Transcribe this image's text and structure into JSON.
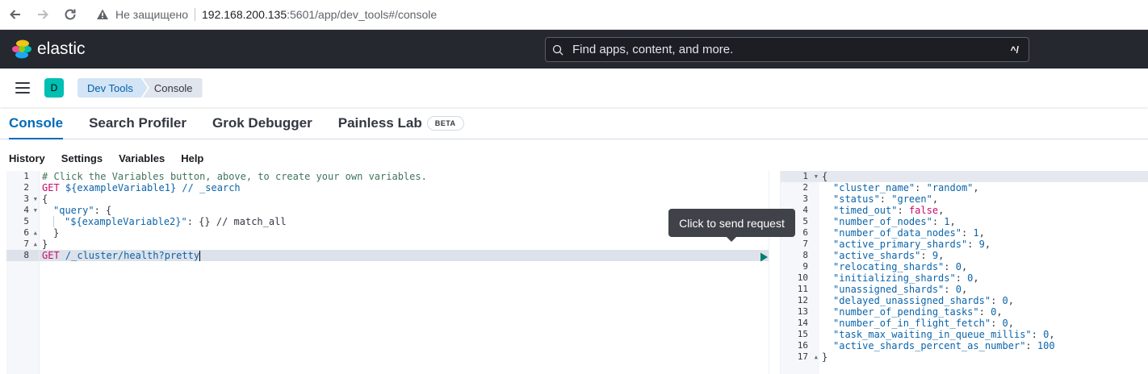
{
  "browser": {
    "insecure_label": "Не защищено",
    "url_host": "192.168.200.135",
    "url_path": ":5601/app/dev_tools#/console"
  },
  "header": {
    "logo_text": "elastic",
    "search_placeholder": "Find apps, content, and more.",
    "search_shortcut": "^/"
  },
  "breadcrumbs": {
    "avatar": "D",
    "items": [
      "Dev Tools",
      "Console"
    ]
  },
  "tabs": [
    {
      "label": "Console",
      "active": true
    },
    {
      "label": "Search Profiler"
    },
    {
      "label": "Grok Debugger"
    },
    {
      "label": "Painless Lab",
      "badge": "BETA"
    }
  ],
  "menu": [
    "History",
    "Settings",
    "Variables",
    "Help"
  ],
  "tooltip": "Click to send request",
  "request_editor": {
    "line_numbers": [
      "1",
      "2",
      "3",
      "4",
      "5",
      "6",
      "7",
      "8"
    ],
    "lines": {
      "l1": "# Click the Variables button, above, to create your own variables.",
      "l2_method": "GET",
      "l2_path": " ${exampleVariable1} // _search",
      "l3": "{",
      "l4_key": "\"query\"",
      "l4_rest": ": {",
      "l5_key": "\"${exampleVariable2}\"",
      "l5_rest": ": {} // match_all",
      "l6": "}",
      "l7": "}",
      "l8_method": "GET",
      "l8_path": " /_cluster/health?pretty"
    }
  },
  "response_editor": {
    "line_numbers": [
      "1",
      "2",
      "3",
      "4",
      "5",
      "6",
      "7",
      "8",
      "9",
      "10",
      "11",
      "12",
      "13",
      "14",
      "15",
      "16",
      "17"
    ],
    "open": "{",
    "close": "}",
    "fields": [
      {
        "key": "\"cluster_name\"",
        "value": "\"random\"",
        "type": "str",
        "comma": ","
      },
      {
        "key": "\"status\"",
        "value": "\"green\"",
        "type": "str",
        "comma": ","
      },
      {
        "key": "\"timed_out\"",
        "value": "false",
        "type": "bool",
        "comma": ","
      },
      {
        "key": "\"number_of_nodes\"",
        "value": "1",
        "type": "num",
        "comma": ","
      },
      {
        "key": "\"number_of_data_nodes\"",
        "value": "1",
        "type": "num",
        "comma": ","
      },
      {
        "key": "\"active_primary_shards\"",
        "value": "9",
        "type": "num",
        "comma": ","
      },
      {
        "key": "\"active_shards\"",
        "value": "9",
        "type": "num",
        "comma": ","
      },
      {
        "key": "\"relocating_shards\"",
        "value": "0",
        "type": "num",
        "comma": ","
      },
      {
        "key": "\"initializing_shards\"",
        "value": "0",
        "type": "num",
        "comma": ","
      },
      {
        "key": "\"unassigned_shards\"",
        "value": "0",
        "type": "num",
        "comma": ","
      },
      {
        "key": "\"delayed_unassigned_shards\"",
        "value": "0",
        "type": "num",
        "comma": ","
      },
      {
        "key": "\"number_of_pending_tasks\"",
        "value": "0",
        "type": "num",
        "comma": ","
      },
      {
        "key": "\"number_of_in_flight_fetch\"",
        "value": "0",
        "type": "num",
        "comma": ","
      },
      {
        "key": "\"task_max_waiting_in_queue_millis\"",
        "value": "0",
        "type": "num",
        "comma": ","
      },
      {
        "key": "\"active_shards_percent_as_number\"",
        "value": "100",
        "type": "num",
        "comma": ""
      }
    ]
  },
  "colors": {
    "header_bg": "#25282f",
    "accent": "#006bb8",
    "avatar": "#00bfb3",
    "keyword": "#c80a68",
    "string": "#0b64aa",
    "comment": "#41755c",
    "run_button": "#017d73"
  }
}
